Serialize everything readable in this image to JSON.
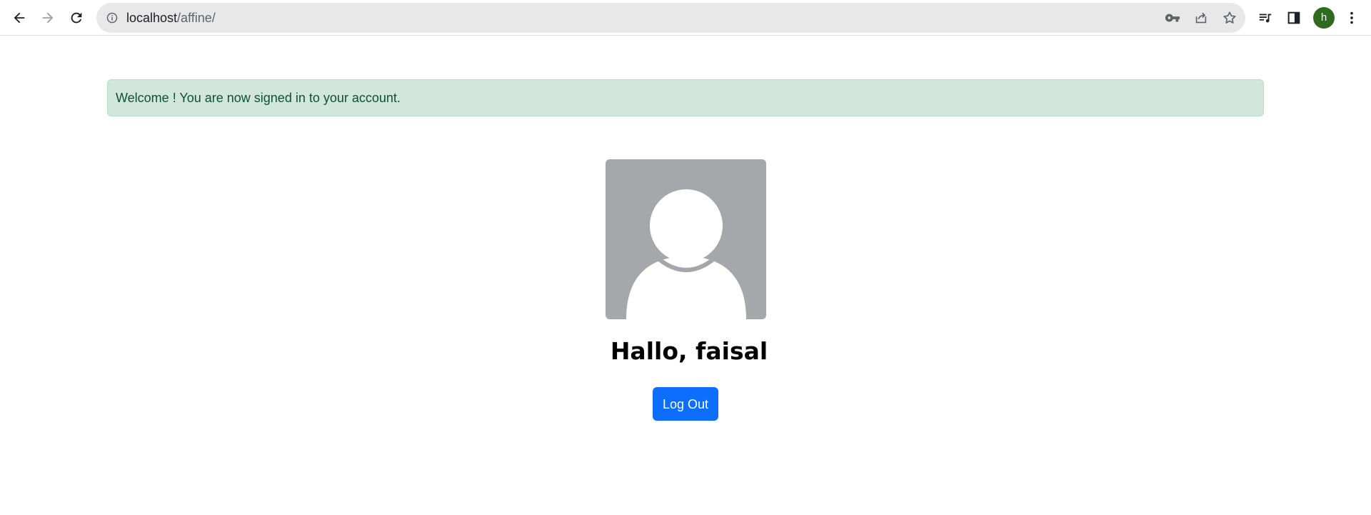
{
  "browser": {
    "url_host": "localhost",
    "url_path": "/affine/",
    "profile_initial": "h",
    "profile_color": "#2e6b1f"
  },
  "alert": {
    "message": "Welcome ! You are now signed in to your account.",
    "color": "#d1e7dd"
  },
  "profile": {
    "greeting": "Hallo, faisal",
    "avatar_icon": "default-user-silhouette-icon"
  },
  "actions": {
    "logout_label": "Log Out",
    "accent": "#0d6efd"
  }
}
